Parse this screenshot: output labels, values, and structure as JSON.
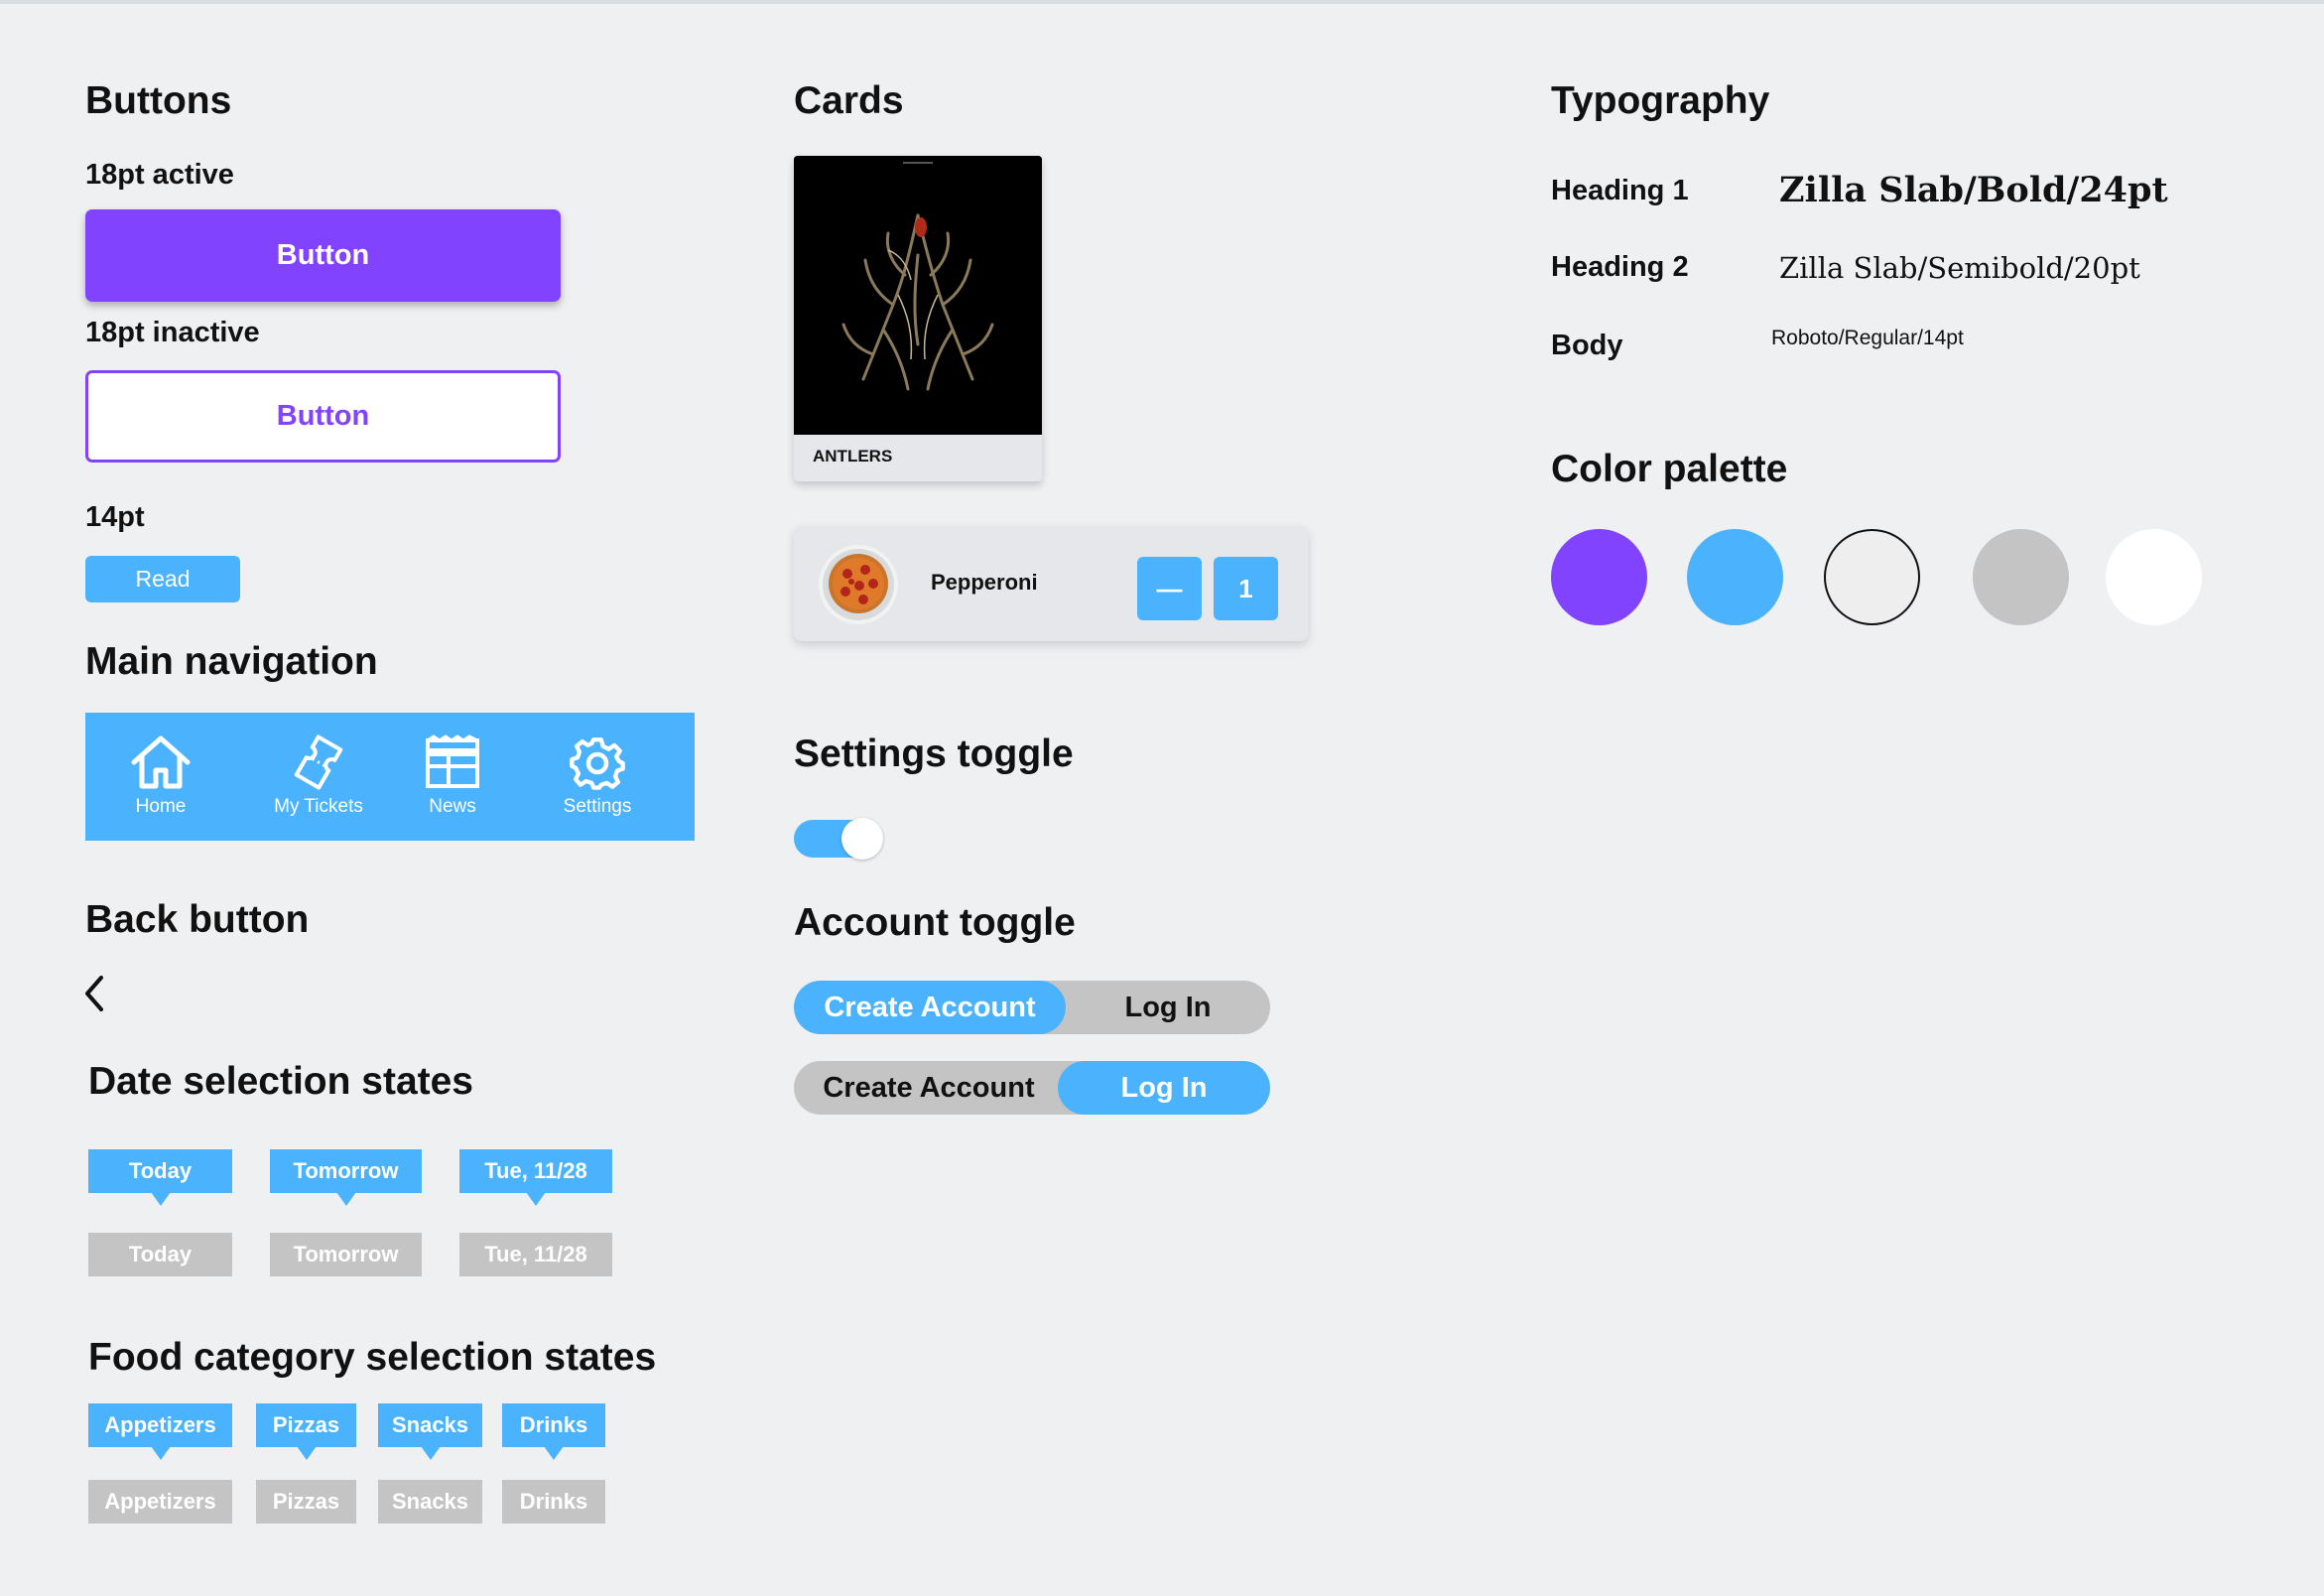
{
  "buttons": {
    "heading": "Buttons",
    "active_label": "18pt active",
    "active_button": "Button",
    "inactive_label": "18pt inactive",
    "inactive_button": "Button",
    "small_label": "14pt",
    "small_button": "Read"
  },
  "main_navigation": {
    "heading": "Main navigation",
    "items": [
      {
        "label": "Home",
        "icon": "home-icon"
      },
      {
        "label": "My Tickets",
        "icon": "ticket-icon"
      },
      {
        "label": "News",
        "icon": "news-icon"
      },
      {
        "label": "Settings",
        "icon": "gear-icon"
      }
    ]
  },
  "back_button": {
    "heading": "Back button",
    "icon": "chevron-left-icon"
  },
  "date_selection": {
    "heading": "Date selection states",
    "selected": [
      "Today",
      "Tomorrow",
      "Tue, 11/28"
    ],
    "unselected": [
      "Today",
      "Tomorrow",
      "Tue, 11/28"
    ]
  },
  "food_selection": {
    "heading": "Food category selection states",
    "selected": [
      "Appetizers",
      "Pizzas",
      "Snacks",
      "Drinks"
    ],
    "unselected": [
      "Appetizers",
      "Pizzas",
      "Snacks",
      "Drinks"
    ]
  },
  "cards": {
    "heading": "Cards",
    "movie_title": "ANTLERS",
    "food_name": "Pepperoni",
    "minus_symbol": "—",
    "quantity": "1"
  },
  "settings_toggle": {
    "heading": "Settings toggle",
    "state": "on"
  },
  "account_toggle": {
    "heading": "Account toggle",
    "create_label": "Create Account",
    "login_label": "Log In"
  },
  "typography": {
    "heading": "Typography",
    "rows": [
      {
        "label": "Heading 1",
        "value": "Zilla Slab/Bold/24pt"
      },
      {
        "label": "Heading 2",
        "value": "Zilla Slab/Semibold/20pt"
      },
      {
        "label": "Body",
        "value": "Roboto/Regular/14pt"
      }
    ]
  },
  "color_palette": {
    "heading": "Color palette",
    "colors": [
      "#8243FF",
      "#4BB3FD",
      "#EEEEEE",
      "#C4C4C4",
      "#FFFFFF"
    ]
  }
}
